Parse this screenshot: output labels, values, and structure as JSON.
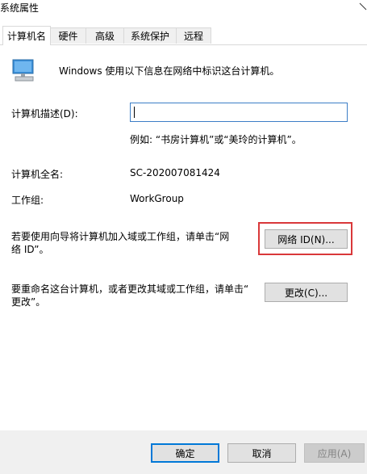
{
  "window": {
    "title": "系统属性"
  },
  "tabs": [
    {
      "label": "计算机名",
      "active": true
    },
    {
      "label": "硬件",
      "active": false
    },
    {
      "label": "高级",
      "active": false
    },
    {
      "label": "系统保护",
      "active": false
    },
    {
      "label": "远程",
      "active": false
    }
  ],
  "computer_name_tab": {
    "intro": "Windows 使用以下信息在网络中标识这台计算机。",
    "description_label": "计算机描述(D):",
    "description_value": "",
    "description_example": "例如: “书房计算机”或“美玲的计算机”。",
    "full_name_label": "计算机全名:",
    "full_name_value": "SC-202007081424",
    "workgroup_label": "工作组:",
    "workgroup_value": "WorkGroup",
    "network_id_text_line1": "若要使用向导将计算机加入域或工作组，请单击“网",
    "network_id_text_line2": "络 ID”。",
    "network_id_button": "网络 ID(N)...",
    "rename_text_line1": "要重命名这台计算机，或者更改其域或工作组，请单击“",
    "rename_text_line2": "更改”。",
    "change_button": "更改(C)..."
  },
  "footer": {
    "ok_button": "确定",
    "cancel_button": "取消",
    "apply_button": "应用(A)"
  },
  "colors": {
    "highlight_border": "#d9383a",
    "input_focus_border": "#3c7ec6",
    "default_button_border": "#0078d7"
  }
}
